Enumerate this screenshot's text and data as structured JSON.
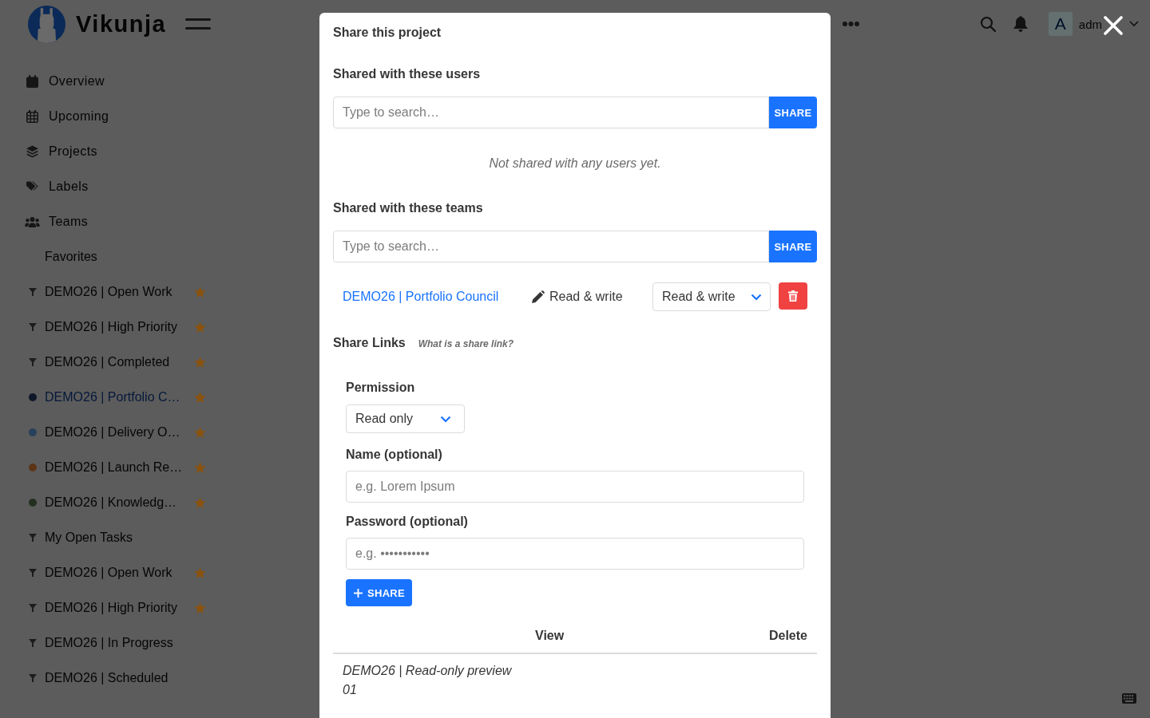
{
  "header": {
    "logo_text": "Vikunja",
    "user": {
      "initial": "A",
      "name": "adm"
    }
  },
  "sidebar": {
    "menu": [
      {
        "label": "Overview"
      },
      {
        "label": "Upcoming"
      },
      {
        "label": "Projects"
      },
      {
        "label": "Labels"
      },
      {
        "label": "Teams"
      }
    ],
    "favorites": {
      "title": "Favorites",
      "items": [
        {
          "label": "DEMO26 | Open Work",
          "kind": "filter",
          "favorite": true,
          "selected": false
        },
        {
          "label": "DEMO26 | High Priority",
          "kind": "filter",
          "favorite": true,
          "selected": false
        },
        {
          "label": "DEMO26 | Completed",
          "kind": "filter",
          "favorite": true,
          "selected": false
        },
        {
          "label": "DEMO26 | Portfolio C…",
          "kind": "project",
          "color": "#0e1829",
          "favorite": true,
          "selected": true
        },
        {
          "label": "DEMO26 | Delivery O…",
          "kind": "project",
          "color": "#27405b",
          "favorite": true,
          "selected": false
        },
        {
          "label": "DEMO26 | Launch Re…",
          "kind": "project",
          "color": "#5c3517",
          "favorite": true,
          "selected": false
        },
        {
          "label": "DEMO26 | Knowledg…",
          "kind": "project",
          "color": "#233020",
          "favorite": true,
          "selected": false
        }
      ]
    },
    "projects": [
      {
        "label": "My Open Tasks",
        "kind": "filter",
        "favorite": false,
        "selected": false
      },
      {
        "label": "DEMO26 | Open Work",
        "kind": "filter",
        "favorite": true,
        "selected": false
      },
      {
        "label": "DEMO26 | High Priority",
        "kind": "filter",
        "favorite": true,
        "selected": false
      },
      {
        "label": "DEMO26 | In Progress",
        "kind": "filter",
        "favorite": false,
        "selected": false
      },
      {
        "label": "DEMO26 | Scheduled",
        "kind": "filter",
        "favorite": false,
        "selected": false
      }
    ]
  },
  "modal": {
    "title": "Share this project",
    "users": {
      "heading": "Shared with these users",
      "search": {
        "placeholder": "Type to search…"
      },
      "button": "SHARE",
      "empty": "Not shared with any users yet."
    },
    "teams": {
      "heading": "Shared with these teams",
      "search": {
        "placeholder": "Type to search…"
      },
      "button": "SHARE",
      "rows": [
        {
          "name": "DEMO26 | Portfolio Council",
          "permission": "Read & write",
          "select_value": "Read & write"
        }
      ]
    },
    "links": {
      "heading": "Share Links",
      "help": "What is a share link?",
      "permission": {
        "label": "Permission",
        "value": "Read only"
      },
      "name": {
        "label": "Name (optional)",
        "placeholder": "e.g. Lorem Ipsum"
      },
      "password": {
        "label": "Password (optional)",
        "placeholder": "e.g. •••••••••••"
      },
      "button": "SHARE",
      "table": {
        "columns": [
          "View",
          "Delete"
        ],
        "rows": [
          {
            "name": "DEMO26 | Read-only preview 01"
          }
        ]
      }
    }
  }
}
